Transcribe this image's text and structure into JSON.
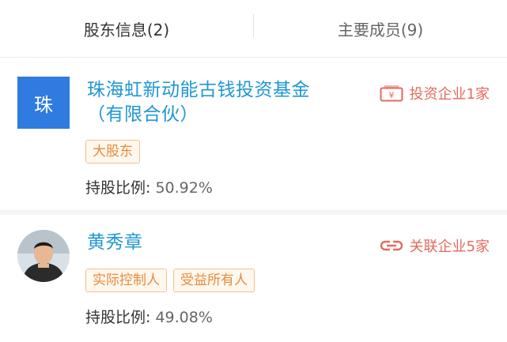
{
  "tabs": [
    {
      "label": "股东信息(2)",
      "active": true
    },
    {
      "label": "主要成员(9)",
      "active": false
    }
  ],
  "shareholders": [
    {
      "avatar_text": "珠",
      "name_line1": "珠海虹新动能古钱投资基金",
      "name_line2": "（有限合伙）",
      "link_label": "投资企业1家",
      "link_icon": "yuan-card-icon",
      "tags": [
        "大股东"
      ],
      "ratio_label": "持股比例:",
      "ratio_value": "50.92%"
    },
    {
      "avatar": "person-photo",
      "name_line1": "黄秀章",
      "link_label": "关联企业5家",
      "link_icon": "chain-link-icon",
      "tags": [
        "实际控制人",
        "受益所有人"
      ],
      "ratio_label": "持股比例:",
      "ratio_value": "49.08%"
    }
  ],
  "colors": {
    "name": "#1f97d4",
    "link": "#e56a5e",
    "tag_text": "#e98a3a",
    "tag_border": "#f1c28f",
    "avatar_bg": "#2f7be0"
  }
}
